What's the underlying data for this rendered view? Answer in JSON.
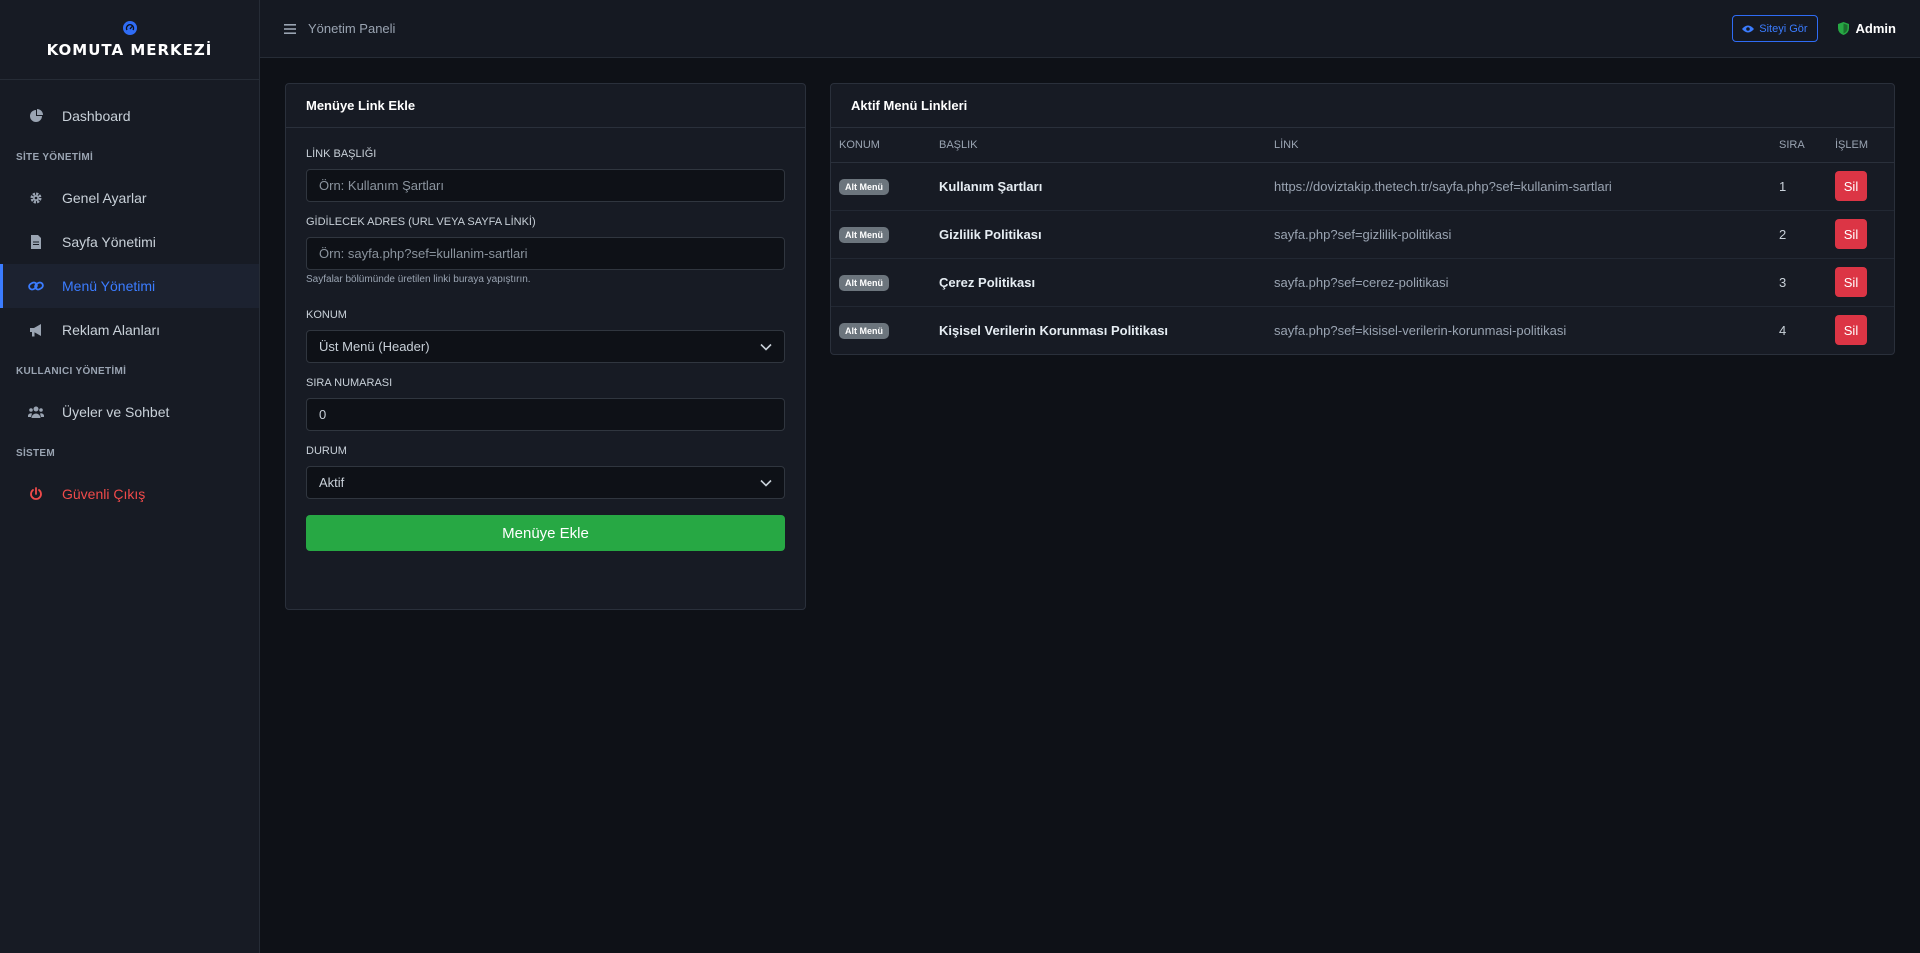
{
  "brand": {
    "title": "KOMUTA MERKEZİ"
  },
  "sidebar": {
    "dashboard": "Dashboard",
    "section_site": "SİTE YÖNETİMİ",
    "genel": "Genel Ayarlar",
    "sayfa": "Sayfa Yönetimi",
    "menu": "Menü Yönetimi",
    "reklam": "Reklam Alanları",
    "section_user": "KULLANICI YÖNETİMİ",
    "uyeler": "Üyeler ve Sohbet",
    "section_system": "SİSTEM",
    "cikis": "Güvenli Çıkış"
  },
  "topbar": {
    "panel_title": "Yönetim Paneli",
    "site_button": "Siteyi Gör",
    "admin_label": "Admin"
  },
  "form": {
    "header": "Menüye Link Ekle",
    "title_label": "LİNK BAŞLIĞI",
    "title_placeholder": "Örn: Kullanım Şartları",
    "url_label": "GİDİLECEK ADRES (URL VEYA SAYFA LİNKİ)",
    "url_placeholder": "Örn: sayfa.php?sef=kullanim-sartlari",
    "url_hint": "Sayfalar bölümünde üretilen linki buraya yapıştırın.",
    "konum_label": "KONUM",
    "konum_value": "Üst Menü (Header)",
    "sira_label": "SIRA NUMARASI",
    "sira_value": "0",
    "durum_label": "DURUM",
    "durum_value": "Aktif",
    "submit": "Menüye Ekle"
  },
  "list": {
    "header": "Aktif Menü Linkleri",
    "columns": {
      "konum": "KONUM",
      "baslik": "BAŞLIK",
      "link": "LİNK",
      "sira": "SIRA",
      "islem": "İŞLEM"
    },
    "rows": [
      {
        "konum": "Alt Menü",
        "baslik": "Kullanım Şartları",
        "link": "https://doviztakip.thetech.tr/sayfa.php?sef=kullanim-sartlari",
        "sira": "1",
        "action": "Sil"
      },
      {
        "konum": "Alt Menü",
        "baslik": "Gizlilik Politikası",
        "link": "sayfa.php?sef=gizlilik-politikasi",
        "sira": "2",
        "action": "Sil"
      },
      {
        "konum": "Alt Menü",
        "baslik": "Çerez Politikası",
        "link": "sayfa.php?sef=cerez-politikasi",
        "sira": "3",
        "action": "Sil"
      },
      {
        "konum": "Alt Menü",
        "baslik": "Kişisel Verilerin Korunması Politikası",
        "link": "sayfa.php?sef=kisisel-verilerin-korunmasi-politikasi",
        "sira": "4",
        "action": "Sil"
      }
    ]
  },
  "colors": {
    "accent": "#3b7cff",
    "success": "#27a844",
    "danger": "#dc3545",
    "background": "#0e1117",
    "sidebar": "#171b24"
  },
  "icons": {
    "brand": "gauge-icon",
    "dashboard": "pie-chart-icon",
    "genel": "gear-icon",
    "sayfa": "file-icon",
    "menu": "link-icon",
    "reklam": "megaphone-icon",
    "uyeler": "users-icon",
    "cikis": "power-icon",
    "topbar_menu": "hamburger-icon",
    "site_button": "eye-icon",
    "admin": "shield-icon",
    "select": "chevron-down-icon"
  }
}
